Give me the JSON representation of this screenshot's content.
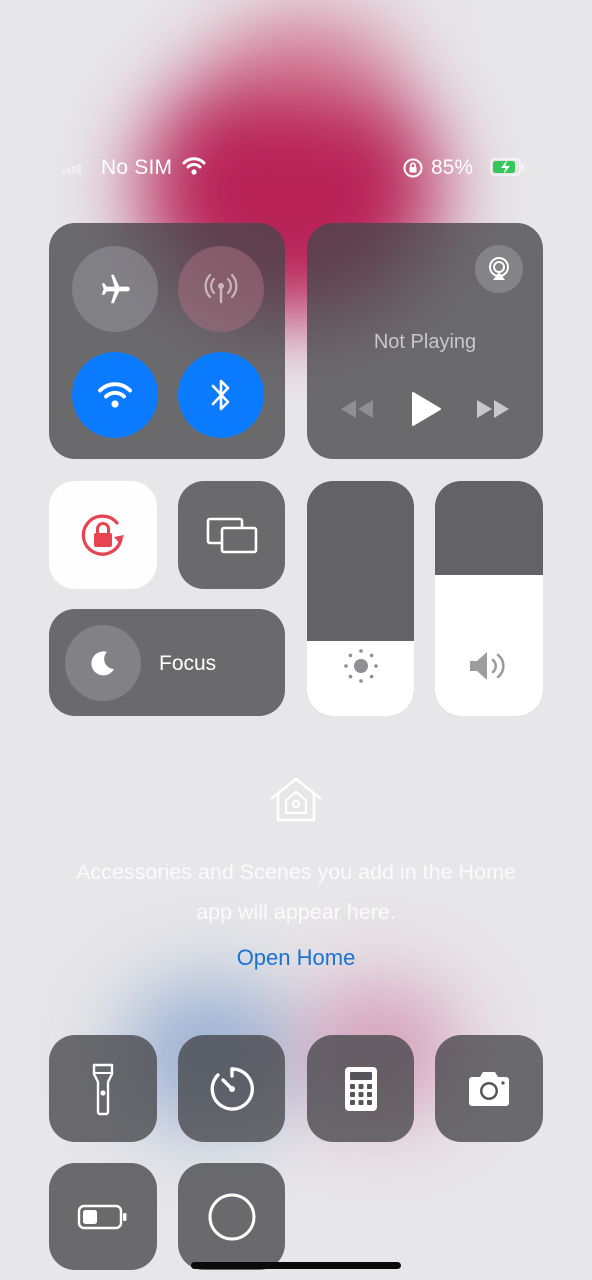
{
  "status_bar": {
    "carrier": "No SIM",
    "battery_percent": "85%",
    "icons": [
      "signal-bars-icon",
      "wifi-icon",
      "orientation-lock-icon",
      "battery-charging-icon"
    ]
  },
  "connectivity": {
    "airplane_mode": false,
    "cellular_data": false,
    "wifi": true,
    "bluetooth": true
  },
  "now_playing": {
    "status": "Not Playing",
    "icons": [
      "airplay-icon",
      "rewind-icon",
      "play-icon",
      "fast-forward-icon"
    ]
  },
  "orientation_lock": {
    "enabled": true
  },
  "focus": {
    "label": "Focus",
    "icon": "moon-icon"
  },
  "brightness": {
    "level": 0.32,
    "icon": "sun-icon"
  },
  "volume": {
    "level": 0.6,
    "icon": "speaker-icon"
  },
  "home": {
    "message": "Accessories and Scenes you add in the Home app will appear here.",
    "open_label": "Open Home"
  },
  "bottom_tools": [
    "flashlight",
    "timer",
    "calculator",
    "camera",
    "low-power-mode",
    "screen-recording"
  ],
  "colors": {
    "accent_blue": "#0a7aff",
    "link_blue": "#1a73d4",
    "lock_red": "#e84350",
    "battery_green": "#34c759"
  }
}
